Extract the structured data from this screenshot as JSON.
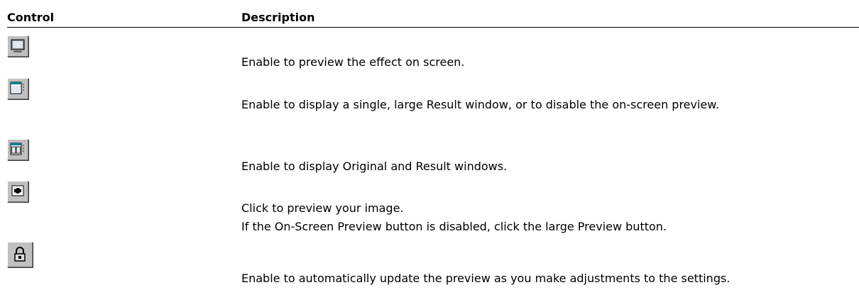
{
  "table": {
    "header": {
      "control": "Control",
      "description": "Description"
    },
    "rows": [
      {
        "icon": "on-screen-preview-icon",
        "description": "Enable to preview the effect on screen."
      },
      {
        "icon": "single-result-window-icon",
        "description": "Enable to display a single, large Result window, or to disable the on-screen preview."
      },
      {
        "icon": "original-and-result-windows-icon",
        "description": "Enable to display Original and Result windows."
      },
      {
        "icon": "preview-icon",
        "description": "Click to preview your image.",
        "note": "If the On-Screen Preview button is disabled, click the large Preview button."
      },
      {
        "icon": "lock-icon",
        "description": "Enable to automatically update the preview as you make adjustments to the settings."
      }
    ]
  }
}
